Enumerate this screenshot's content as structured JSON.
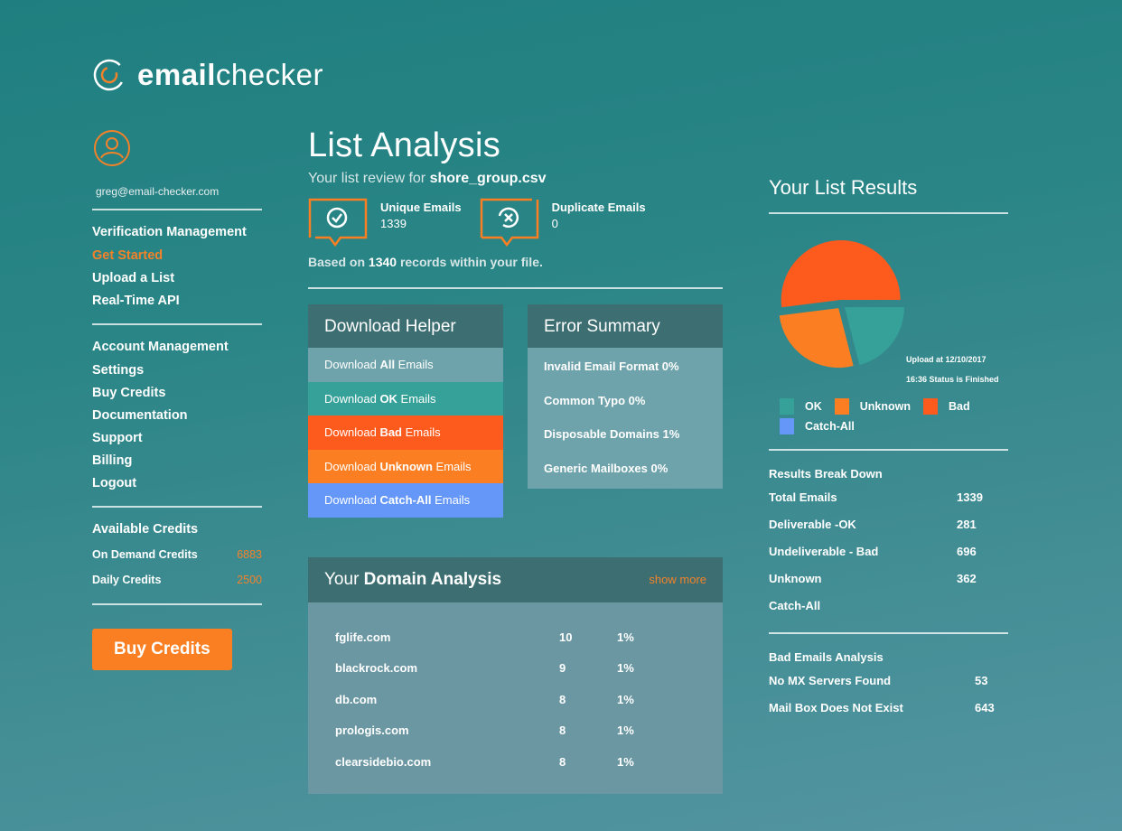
{
  "app": {
    "logo_prefix": "email",
    "logo_suffix": "checker",
    "accent_color": "#f2822a"
  },
  "sidebar": {
    "user_email": "greg@email-checker.com",
    "sections": [
      {
        "title": "Verification Management",
        "items": [
          {
            "label": "Get Started",
            "active": true
          },
          {
            "label": "Upload a List",
            "active": false
          },
          {
            "label": "Real-Time API",
            "active": false
          }
        ]
      },
      {
        "title": "Account Management",
        "items": [
          {
            "label": "Settings"
          },
          {
            "label": "Buy Credits"
          },
          {
            "label": "Documentation"
          },
          {
            "label": "Support"
          },
          {
            "label": "Billing"
          },
          {
            "label": "Logout"
          }
        ]
      }
    ],
    "credits": {
      "title": "Available Credits",
      "rows": [
        {
          "label": "On Demand Credits",
          "value": "6883"
        },
        {
          "label": "Daily Credits",
          "value": "2500"
        }
      ]
    },
    "buy_button": "Buy Credits"
  },
  "main": {
    "title": "List Analysis",
    "subtitle_prefix": "Your list review for ",
    "filename": "shore_group.csv",
    "stats": [
      {
        "label": "Unique Emails",
        "value": "1339",
        "icon": "check-circle-icon"
      },
      {
        "label": "Duplicate Emails",
        "value": "0",
        "icon": "x-circle-icon"
      }
    ],
    "based_prefix": "Based on ",
    "based_count": "1340",
    "based_suffix": " records within your file.",
    "download_helper": {
      "title": "Download Helper",
      "items": [
        {
          "pre": "Download ",
          "bold": "All",
          "post": " Emails",
          "color": "#6fa3ab"
        },
        {
          "pre": "Download ",
          "bold": "OK",
          "post": " Emails",
          "color": "#36a199"
        },
        {
          "pre": "Download ",
          "bold": "Bad",
          "post": " Emails",
          "color": "#fd5a1e"
        },
        {
          "pre": "Download ",
          "bold": "Unknown",
          "post": " Emails",
          "color": "#fb7f22"
        },
        {
          "pre": "Download ",
          "bold": "Catch-All",
          "post": " Emails",
          "color": "#6497f7"
        }
      ]
    },
    "error_summary": {
      "title": "Error Summary",
      "items": [
        "Invalid Email Format 0%",
        "Common Typo 0%",
        "Disposable Domains 1%",
        "Generic Mailboxes 0%"
      ]
    },
    "domain_analysis": {
      "title_pre": "Your ",
      "title_bold": "Domain Analysis",
      "show_more": "show more",
      "rows": [
        {
          "domain": "fglife.com",
          "count": "10",
          "percent": "1%"
        },
        {
          "domain": "blackrock.com",
          "count": "9",
          "percent": "1%"
        },
        {
          "domain": "db.com",
          "count": "8",
          "percent": "1%"
        },
        {
          "domain": "prologis.com",
          "count": "8",
          "percent": "1%"
        },
        {
          "domain": "clearsidebio.com",
          "count": "8",
          "percent": "1%"
        }
      ]
    }
  },
  "results": {
    "title": "Your List Results",
    "upload_line1": "Upload at 12/10/2017",
    "upload_line2": "16:36 Status is Finished",
    "legend": [
      {
        "label": "OK",
        "color": "#36a199"
      },
      {
        "label": "Unknown",
        "color": "#fb7f22"
      },
      {
        "label": "Bad",
        "color": "#fd5a1e"
      },
      {
        "label": "Catch-All",
        "color": "#6497f7"
      }
    ],
    "breakdown_title": "Results Break Down",
    "breakdown": [
      {
        "label": "Total Emails",
        "value": "1339"
      },
      {
        "label": "Deliverable -OK",
        "value": "281"
      },
      {
        "label": "Undeliverable - Bad",
        "value": "696"
      },
      {
        "label": "Unknown",
        "value": "362"
      },
      {
        "label": "Catch-All",
        "value": ""
      }
    ],
    "bad_title": "Bad Emails Analysis",
    "bad": [
      {
        "label": "No MX Servers Found",
        "value": "53"
      },
      {
        "label": "Mail Box Does Not Exist",
        "value": "643"
      }
    ]
  },
  "chart_data": {
    "type": "pie",
    "title": "",
    "categories": [
      "Bad",
      "Unknown",
      "OK",
      "Catch-All"
    ],
    "values": [
      696,
      362,
      281,
      0
    ],
    "colors": [
      "#fd5a1e",
      "#fb7f22",
      "#36a199",
      "#6497f7"
    ],
    "legend": "bottom"
  }
}
